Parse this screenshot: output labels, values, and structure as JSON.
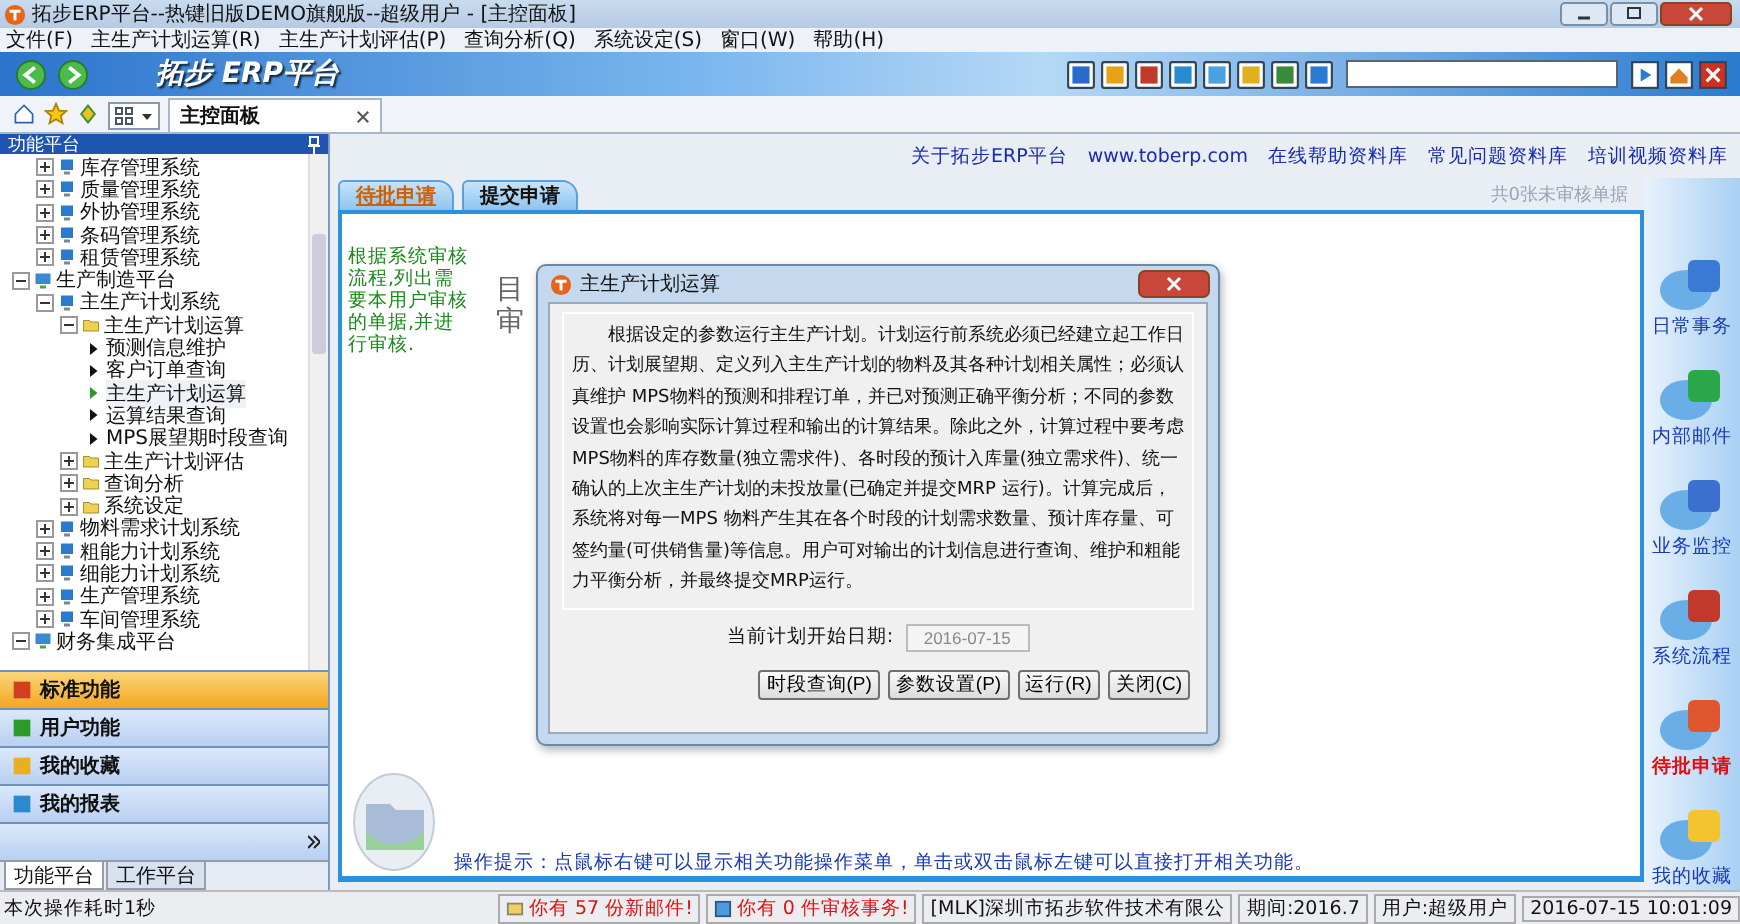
{
  "window": {
    "title": "拓步ERP平台--热键旧版DEMO旗舰版--超级用户 - [主控面板]"
  },
  "menu": [
    "文件(F)",
    "主生产计划运算(R)",
    "主生产计划评估(P)",
    "查询分析(Q)",
    "系统设定(S)",
    "窗口(W)",
    "帮助(H)"
  ],
  "banner": {
    "logo": "拓步 ERP平台"
  },
  "doc_tabs": [
    {
      "label": "主控面板",
      "selected": true
    }
  ],
  "left_panel": {
    "title": "功能平台",
    "tree": [
      {
        "kind": "offscreen",
        "children": [
          {
            "kind": "system",
            "label": "库存管理系统",
            "expanded": false
          },
          {
            "kind": "system",
            "label": "质量管理系统",
            "expanded": false
          },
          {
            "kind": "system",
            "label": "外协管理系统",
            "expanded": false
          },
          {
            "kind": "system",
            "label": "条码管理系统",
            "expanded": false
          },
          {
            "kind": "system",
            "label": "租赁管理系统",
            "expanded": false
          }
        ]
      },
      {
        "kind": "platform",
        "label": "生产制造平台",
        "expanded": true,
        "children": [
          {
            "kind": "system",
            "label": "主生产计划系统",
            "expanded": true,
            "children": [
              {
                "kind": "folder",
                "label": "主生产计划运算",
                "expanded": true,
                "children": [
                  {
                    "kind": "function",
                    "label": "预测信息维护",
                    "selected": false
                  },
                  {
                    "kind": "function",
                    "label": "客户订单查询",
                    "selected": false
                  },
                  {
                    "kind": "function",
                    "label": "主生产计划运算",
                    "selected": true
                  },
                  {
                    "kind": "function",
                    "label": "运算结果查询",
                    "selected": false
                  },
                  {
                    "kind": "function",
                    "label": "MPS展望期时段查询",
                    "selected": false
                  }
                ]
              },
              {
                "kind": "folder",
                "label": "主生产计划评估",
                "expanded": false
              },
              {
                "kind": "folder",
                "label": "查询分析",
                "expanded": false
              },
              {
                "kind": "folder",
                "label": "系统设定",
                "expanded": false
              }
            ]
          },
          {
            "kind": "system",
            "label": "物料需求计划系统",
            "expanded": false
          },
          {
            "kind": "system",
            "label": "粗能力计划系统",
            "expanded": false
          },
          {
            "kind": "system",
            "label": "细能力计划系统",
            "expanded": false
          },
          {
            "kind": "system",
            "label": "生产管理系统",
            "expanded": false
          },
          {
            "kind": "system",
            "label": "车间管理系统",
            "expanded": false
          }
        ]
      },
      {
        "kind": "platform",
        "label": "财务集成平台",
        "expanded": true
      }
    ],
    "sections": [
      {
        "label": "标准功能",
        "selected": true
      },
      {
        "label": "用户功能",
        "selected": false
      },
      {
        "label": "我的收藏",
        "selected": false
      },
      {
        "label": "我的报表",
        "selected": false
      }
    ],
    "bottom_tabs": [
      {
        "label": "功能平台",
        "selected": true
      },
      {
        "label": "工作平台",
        "selected": false
      }
    ]
  },
  "links": [
    "关于拓步ERP平台",
    "www.toberp.com",
    "在线帮助资料库",
    "常见问题资料库",
    "培训视频资料库"
  ],
  "approval_tabs": [
    {
      "label": "待批申请",
      "selected": true
    },
    {
      "label": "提交申请",
      "selected": false
    }
  ],
  "pending_count": "共0张未审核单据",
  "panel": {
    "hint": "根据系统审核流程,列出需要本用户审核的单据,并进行审核.",
    "covered_heading": [
      "目",
      "审"
    ],
    "tip": "操作提示：点鼠标右键可以显示相关功能操作菜单，单击或双击鼠标左键可以直接打开相关功能。"
  },
  "shortcuts": [
    {
      "label": "日常事务",
      "selected": false
    },
    {
      "label": "内部邮件",
      "selected": false
    },
    {
      "label": "业务监控",
      "selected": false
    },
    {
      "label": "系统流程",
      "selected": false
    },
    {
      "label": "待批申请",
      "selected": true
    },
    {
      "label": "我的收藏",
      "selected": false
    }
  ],
  "dialog": {
    "title": "主生产计划运算",
    "description": "根据设定的参数运行主生产计划。计划运行前系统必须已经建立起工作日历、计划展望期、定义列入主生产计划的物料及其各种计划相关属性；必须认真维护 MPS物料的预测和排程订单，并已对预测正确平衡分析；不同的参数设置也会影响实际计算过程和输出的计算结果。除此之外，计算过程中要考虑 MPS物料的库存数量(独立需求件)、各时段的预计入库量(独立需求件)、统一确认的上次主生产计划的未投放量(已确定并提交MRP 运行)。计算完成后，系统将对每一MPS 物料产生其在各个时段的计划需求数量、预计库存量、可签约量(可供销售量)等信息。用户可对输出的计划信息进行查询、维护和粗能力平衡分析，并最终提交MRP运行。",
    "date_label": "当前计划开始日期:",
    "date_value": "2016-07-15",
    "date_disabled": true,
    "buttons": [
      "时段查询(P)",
      "参数设置(P)",
      "运行(R)",
      "关闭(C)"
    ]
  },
  "status_bar": {
    "message": "本次操作耗时1秒",
    "mail": "你有 57 份新邮件!",
    "audit": "你有 0 件审核事务!",
    "company": "[MLK]深圳市拓步软件技术有限公",
    "period": "期间:2016.7",
    "user": "用户:超级用户",
    "time": "2016-07-15 10:01:09"
  }
}
